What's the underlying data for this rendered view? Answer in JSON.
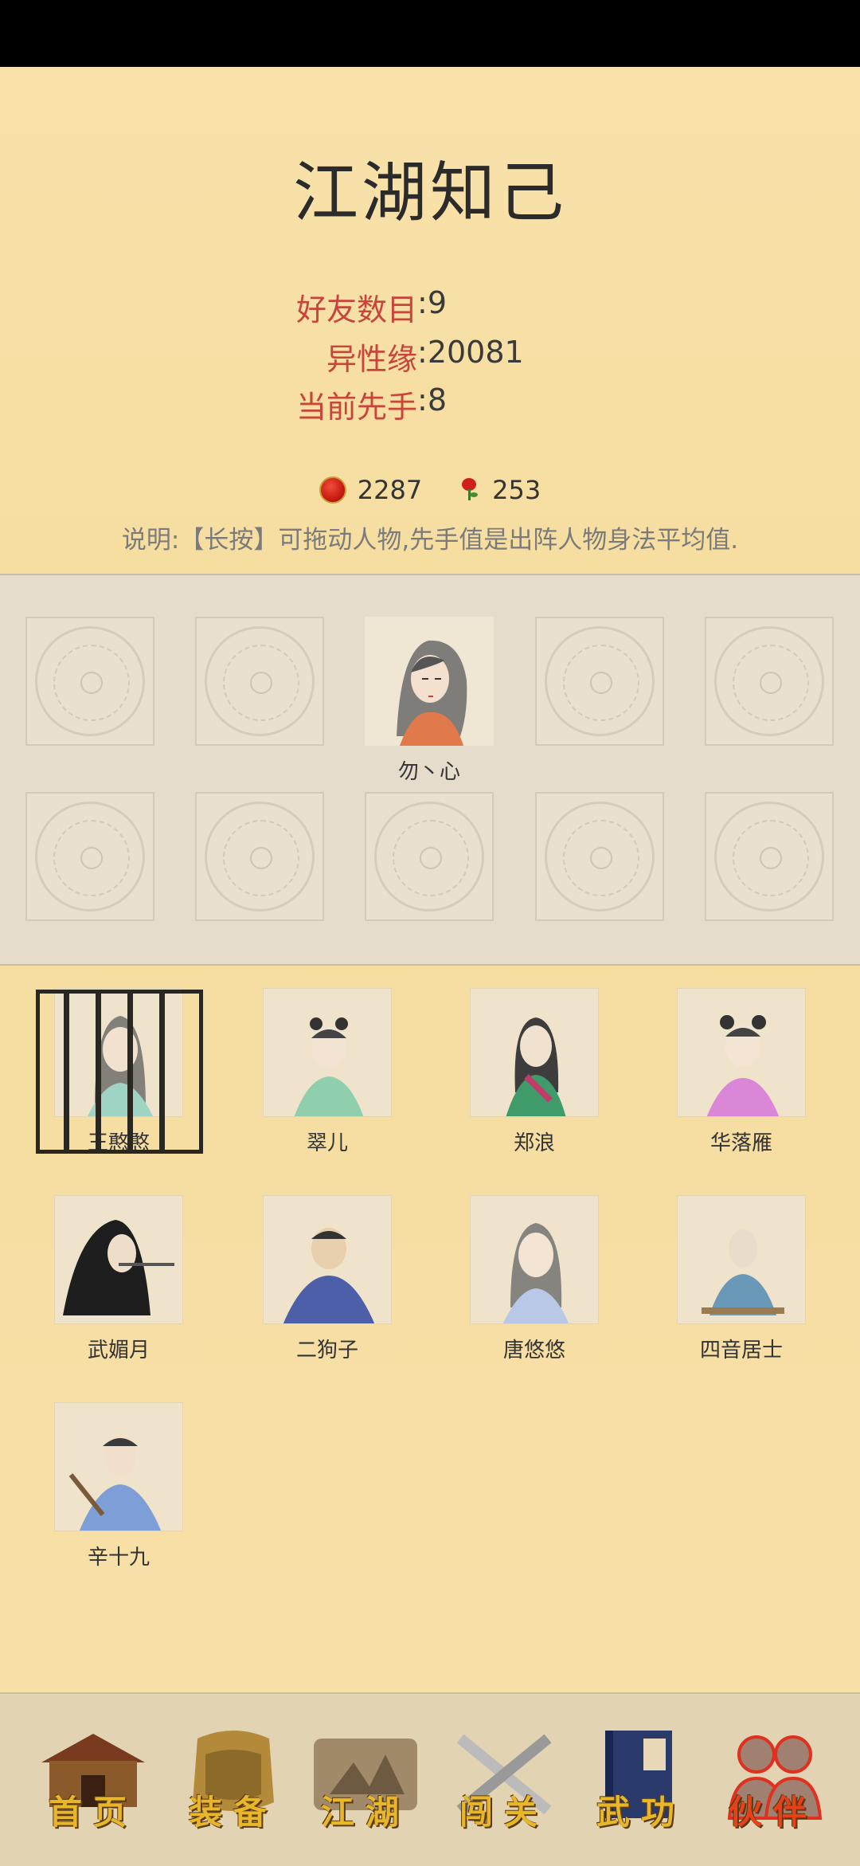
{
  "title": "江湖知己",
  "stats": [
    {
      "label": "好友数目",
      "value": "9"
    },
    {
      "label": "异性缘",
      "value": "20081"
    },
    {
      "label": "当前先手",
      "value": "8"
    }
  ],
  "currency": {
    "coins": "2287",
    "roses": "253"
  },
  "note": "说明:【长按】可拖动人物,先手值是出阵人物身法平均值.",
  "lineup": {
    "active_member": "勿丶心"
  },
  "roster": [
    {
      "name": "王憨憨",
      "locked": true
    },
    {
      "name": "翠儿"
    },
    {
      "name": "郑浪"
    },
    {
      "name": "华落雁"
    },
    {
      "name": "武媚月"
    },
    {
      "name": "二狗子"
    },
    {
      "name": "唐悠悠"
    },
    {
      "name": "四音居士"
    },
    {
      "name": "辛十九"
    }
  ],
  "nav": [
    {
      "label": "首页",
      "icon": "house-icon"
    },
    {
      "label": "装备",
      "icon": "armor-icon"
    },
    {
      "label": "江湖",
      "icon": "map-scroll-icon"
    },
    {
      "label": "闯关",
      "icon": "crossed-swords-icon"
    },
    {
      "label": "武功",
      "icon": "book-icon"
    },
    {
      "label": "伙伴",
      "icon": "partners-icon",
      "active": true
    }
  ],
  "colors": {
    "accent_red": "#c9443a",
    "paper": "#f7e0a6",
    "nav_gold": "#e8b62a"
  }
}
